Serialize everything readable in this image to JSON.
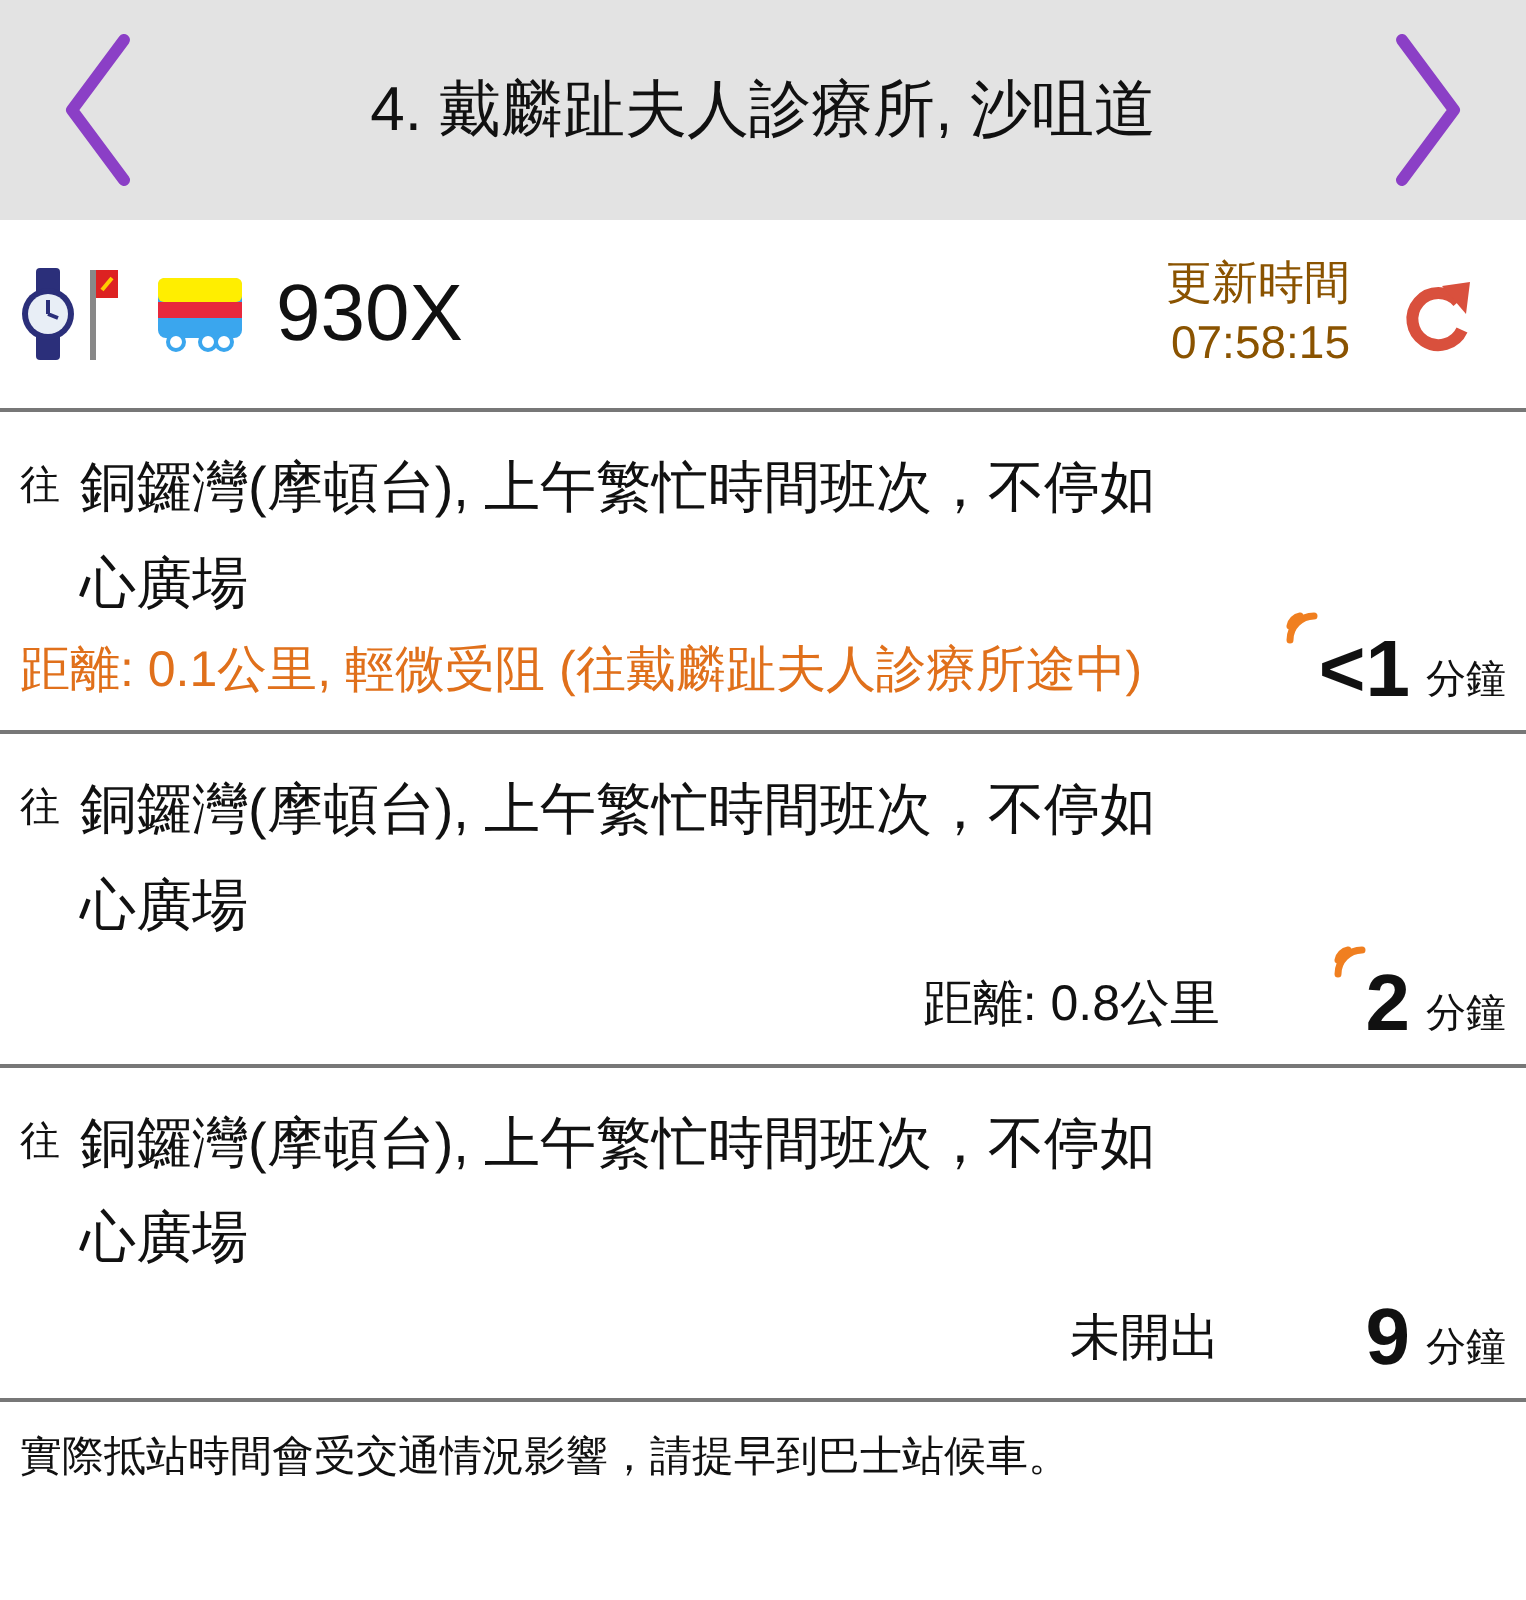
{
  "header": {
    "title": "4. 戴麟趾夫人診療所, 沙咀道"
  },
  "route": {
    "number": "930X",
    "updated_label": "更新時間",
    "updated_time": "07:58:15"
  },
  "etas": [
    {
      "prefix": "往",
      "destination": "銅鑼灣(摩頓台), 上午繁忙時間班次，不停如心廣場",
      "kind": "alert",
      "note": "距離: 0.1公里, 輕微受阻 (往戴麟趾夫人診療所途中)",
      "eta": "<1",
      "unit": "分鐘",
      "realtime": true
    },
    {
      "prefix": "往",
      "destination": "銅鑼灣(摩頓台), 上午繁忙時間班次，不停如心廣場",
      "kind": "plain",
      "note": "距離: 0.8公里",
      "eta": "2",
      "unit": "分鐘",
      "realtime": true
    },
    {
      "prefix": "往",
      "destination": "銅鑼灣(摩頓台), 上午繁忙時間班次，不停如心廣場",
      "kind": "plain",
      "note": "未開出",
      "eta": "9",
      "unit": "分鐘",
      "realtime": false
    }
  ],
  "footer": "實際抵站時間會受交通情況影響，請提早到巴士站候車。"
}
